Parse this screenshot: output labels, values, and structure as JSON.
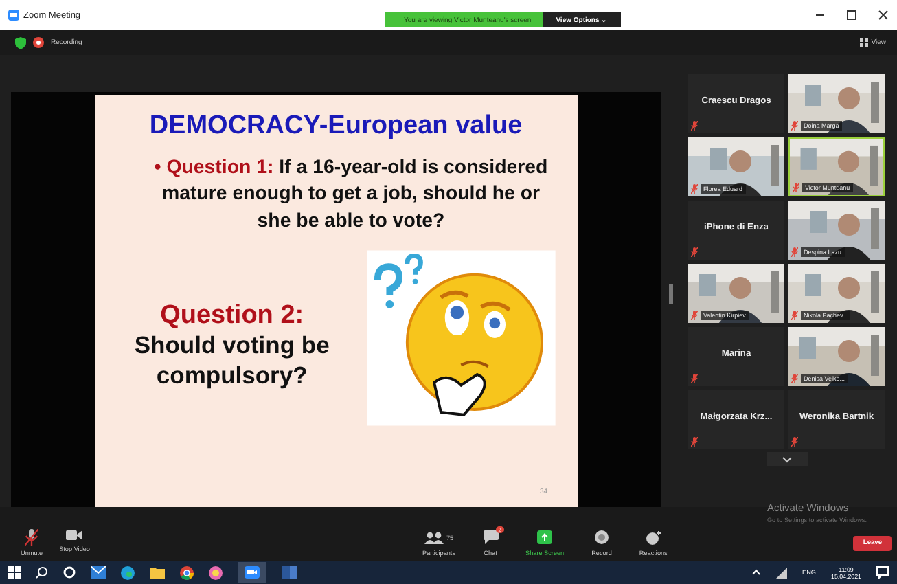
{
  "window": {
    "title": "Zoom Meeting"
  },
  "share_banner": {
    "text": "You are viewing Victor Munteanu's screen",
    "options": "View Options ⌄"
  },
  "meeting_bar": {
    "recording": "Recording",
    "view": "View"
  },
  "slide": {
    "title": "DEMOCRACY-European value",
    "bullet": "•",
    "q1_label": "Question 1:",
    "q1_text": "If a 16-year-old is considered mature enough to get a job, should he or she be able to vote?",
    "q2_label": "Question 2:",
    "q2_text": "Should voting be compulsory?",
    "page": "34"
  },
  "gallery": [
    {
      "kind": "name",
      "name": "Craescu Dragos",
      "selected": false
    },
    {
      "kind": "video",
      "name": "Doina Marga",
      "selected": false
    },
    {
      "kind": "video",
      "name": "Florea Eduard",
      "selected": false
    },
    {
      "kind": "video",
      "name": "Victor Munteanu",
      "selected": true
    },
    {
      "kind": "name",
      "name": "iPhone di Enza",
      "selected": false
    },
    {
      "kind": "video",
      "name": "Despina Lazu",
      "selected": false
    },
    {
      "kind": "video",
      "name": "Valentin Kirpiev",
      "selected": false
    },
    {
      "kind": "video",
      "name": "Nikola Pachev...",
      "selected": false
    },
    {
      "kind": "name",
      "name": "Marina",
      "selected": false
    },
    {
      "kind": "video",
      "name": "Denisa Veiko...",
      "selected": false
    },
    {
      "kind": "name",
      "name": "Małgorzata  Krz...",
      "selected": false
    },
    {
      "kind": "name",
      "name": "Weronika Bartnik",
      "selected": false
    }
  ],
  "toolbar": {
    "left": [
      {
        "kind": "mic",
        "label": "Unmute"
      },
      {
        "kind": "video",
        "label": "Stop Video"
      }
    ],
    "center": [
      {
        "kind": "participants",
        "label": "Participants",
        "count": "75"
      },
      {
        "kind": "chat",
        "label": "Chat",
        "badge": "2"
      },
      {
        "kind": "share",
        "label": "Share Screen"
      },
      {
        "kind": "record",
        "label": "Record"
      },
      {
        "kind": "reactions",
        "label": "Reactions"
      }
    ],
    "leave": "Leave"
  },
  "activation": {
    "title": "Activate Windows",
    "text": "Go to Settings to activate Windows."
  },
  "taskbar": {
    "language": "ENG",
    "time": "11:09",
    "date": "15.04.2021"
  }
}
